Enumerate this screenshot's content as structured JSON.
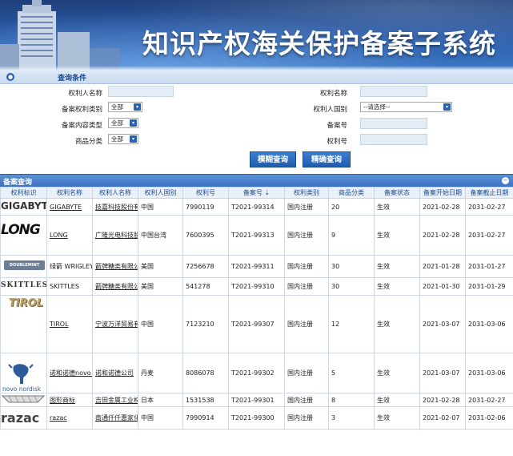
{
  "header": {
    "title": "知识产权海关保护备案子系统"
  },
  "query": {
    "section_title": "查询条件",
    "rights_holder_label": "权利人名称",
    "right_name_label": "权利名称",
    "right_category_label": "备案权利类别",
    "right_category_value": "全部",
    "holder_country_label": "权利人国别",
    "holder_country_value": "--请选择--",
    "content_type_label": "备案内容类型",
    "content_type_value": "全部",
    "record_no_label": "备案号",
    "goods_class_label": "商品分类",
    "goods_class_value": "全部",
    "right_no_label": "权利号",
    "fuzzy_button": "模糊查询",
    "exact_button": "精确查询"
  },
  "results": {
    "section_title": "备案查询",
    "columns": [
      "权利标识",
      "权利名称",
      "权利人名称",
      "权利人国别",
      "权利号",
      "备案号 ⇣",
      "权利类别",
      "商品分类",
      "备案状态",
      "备案开始日期",
      "备案截止日期"
    ],
    "rows": [
      {
        "logo": "GIGABYTE",
        "name": "GIGABYTE",
        "holder": "技嘉科技股份有限公司",
        "country": "中国",
        "right_no": "7990119",
        "record_no": "T2021-99314",
        "category": "国内注册",
        "goods": "20",
        "status": "生效",
        "start": "2021-02-28",
        "end": "2031-02-27"
      },
      {
        "logo": "LONG",
        "name": "LONG",
        "holder": "广隆光电科技股份有限公司",
        "country": "中国台湾",
        "right_no": "7600395",
        "record_no": "T2021-99313",
        "category": "国内注册",
        "goods": "9",
        "status": "生效",
        "start": "2021-02-28",
        "end": "2031-02-27"
      },
      {
        "logo": "DOUBLEMINT",
        "name": "绿箭 WRIGLEY",
        "holder": "箭牌糖类有限公司",
        "country": "美国",
        "right_no": "7256678",
        "record_no": "T2021-99311",
        "category": "国内注册",
        "goods": "30",
        "status": "生效",
        "start": "2021-01-28",
        "end": "2031-01-27"
      },
      {
        "logo": "SKITTLES",
        "name": "SKITTLES",
        "holder": "箭牌糖类有限公司",
        "country": "美国",
        "right_no": "541278",
        "record_no": "T2021-99310",
        "category": "国内注册",
        "goods": "30",
        "status": "生效",
        "start": "2021-01-30",
        "end": "2031-01-29"
      },
      {
        "logo": "TIROL",
        "name": "TIROL",
        "holder": "宁波万洋贸易有限公司",
        "country": "中国",
        "right_no": "7123210",
        "record_no": "T2021-99307",
        "category": "国内注册",
        "goods": "12",
        "status": "生效",
        "start": "2021-03-07",
        "end": "2031-03-06"
      },
      {
        "logo": "novo nordisk",
        "name": "诺和诺德novo nordisk",
        "holder": "诺和诺德公司",
        "country": "丹麦",
        "right_no": "8086078",
        "record_no": "T2021-99302",
        "category": "国内注册",
        "goods": "5",
        "status": "生效",
        "start": "2021-03-07",
        "end": "2031-03-06"
      },
      {
        "logo": "",
        "name": "图形商标",
        "holder": "吉田金属工业株式会社",
        "country": "日本",
        "right_no": "1531538",
        "record_no": "T2021-99301",
        "category": "国内注册",
        "goods": "8",
        "status": "生效",
        "start": "2021-02-28",
        "end": "2031-02-27"
      },
      {
        "logo": "razac",
        "name": "razac",
        "holder": "南通仟仟惠家化有限公司",
        "country": "中国",
        "right_no": "7990914",
        "record_no": "T2021-99300",
        "category": "国内注册",
        "goods": "3",
        "status": "生效",
        "start": "2021-02-07",
        "end": "2031-02-06"
      }
    ]
  },
  "colors": {
    "banner": "#2a5aa6",
    "button": "#2b63b4",
    "header_bar": "#3c72bf"
  }
}
